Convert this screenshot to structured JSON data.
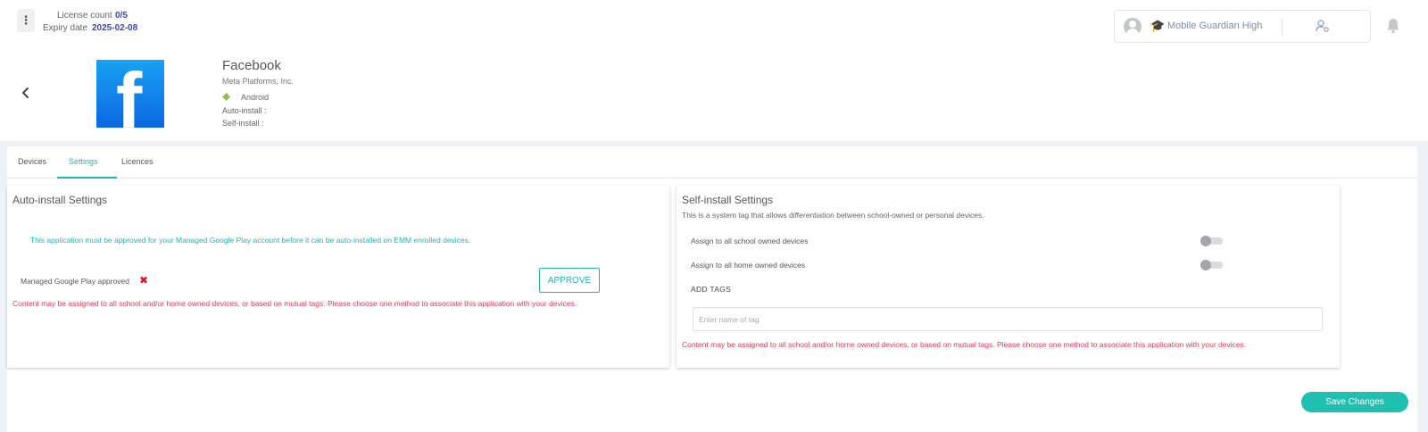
{
  "license": {
    "count_label": "License count",
    "count_value": "0/5",
    "expiry_label": "Expiry date",
    "expiry_value": "2025-02-08"
  },
  "school": {
    "name": "Mobile Guardian High"
  },
  "app": {
    "name": "Facebook",
    "developer": "Meta Platforms, Inc.",
    "platform": "Android",
    "auto_install_label": "Auto-install :",
    "self_install_label": "Self-install :",
    "logo_letter": "f",
    "logo_color": "#1877f2"
  },
  "tabs": [
    {
      "label": "Devices"
    },
    {
      "label": "Settings"
    },
    {
      "label": "Licences"
    }
  ],
  "auto_install": {
    "title": "Auto-install Settings",
    "notice": "This application must be approved for your Managed Google Play account before it can be auto-installed on EMM enrolled devices.",
    "approved_label": "Managed Google Play approved",
    "approve_button": "APPROVE",
    "warning": "Content may be assigned to all school and/or home owned devices, or based on mutual tags. Please choose one method to associate this application with your devices."
  },
  "self_install": {
    "title": "Self-install Settings",
    "description": "This is a system tag that allows differentiation between school-owned or personal devices.",
    "assign_school": "Assign to all school owned devices",
    "assign_home": "Assign to all home owned devices",
    "add_tags_label": "ADD TAGS",
    "tag_placeholder": "Enter name of tag",
    "warning": "Content may be assigned to all school and/or home owned devices, or based on mutual tags. Please choose one method to associate this application with your devices."
  },
  "save_button": "Save Changes",
  "colors": {
    "accent": "#1fb6b0",
    "link_blue": "#3a47c8",
    "error": "#e03a55"
  }
}
